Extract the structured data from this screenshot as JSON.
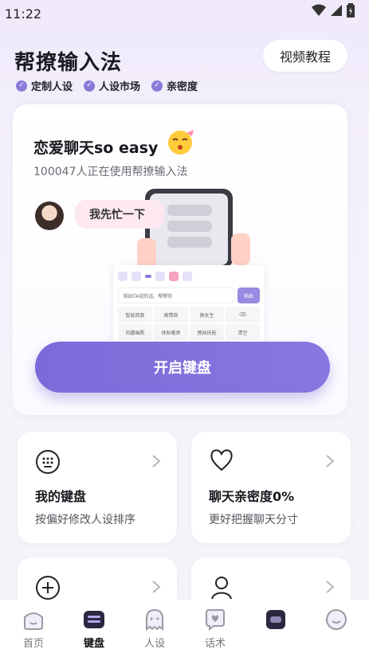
{
  "status_bar": {
    "time": "11:22"
  },
  "header": {
    "title": "帮撩输入法",
    "video_button": "视频教程",
    "features": [
      "定制人设",
      "人设市场",
      "亲密度"
    ]
  },
  "hero": {
    "title": "恋爱聊天so easy",
    "subtitle": "100047人正在使用帮撩输入法",
    "chat_bubble": "我先忙一下",
    "keyboard_preview": {
      "placeholder": "粘贴TA说的话，帮帮你",
      "send": "粘贴",
      "keys": [
        "智能回复",
        "高情商",
        "换女生",
        "",
        "风趣幽默",
        "体贴暖男",
        "撩妹技能",
        "清空"
      ]
    },
    "open_button": "开启键盘"
  },
  "cards": [
    {
      "title": "我的键盘",
      "desc": "按偏好修改人设排序",
      "icon": "keyboard-icon"
    },
    {
      "title": "聊天亲密度0%",
      "desc": "更好把握聊天分寸",
      "icon": "heart-icon"
    },
    {
      "title": "",
      "desc": "",
      "icon": "plus-circle-icon"
    },
    {
      "title": "",
      "desc": "",
      "icon": "person-icon"
    }
  ],
  "tabbar": {
    "items": [
      {
        "label": "首页",
        "icon": "home-icon"
      },
      {
        "label": "键盘",
        "icon": "keyboard-icon",
        "active": true
      },
      {
        "label": "人设",
        "icon": "ghost-icon"
      },
      {
        "label": "话术",
        "icon": "chat-heart-icon"
      },
      {
        "label": "",
        "icon": "square-icon"
      },
      {
        "label": "",
        "icon": "face-icon"
      }
    ]
  },
  "colors": {
    "accent": "#7b6ad8",
    "background": "#f4f0fb"
  }
}
